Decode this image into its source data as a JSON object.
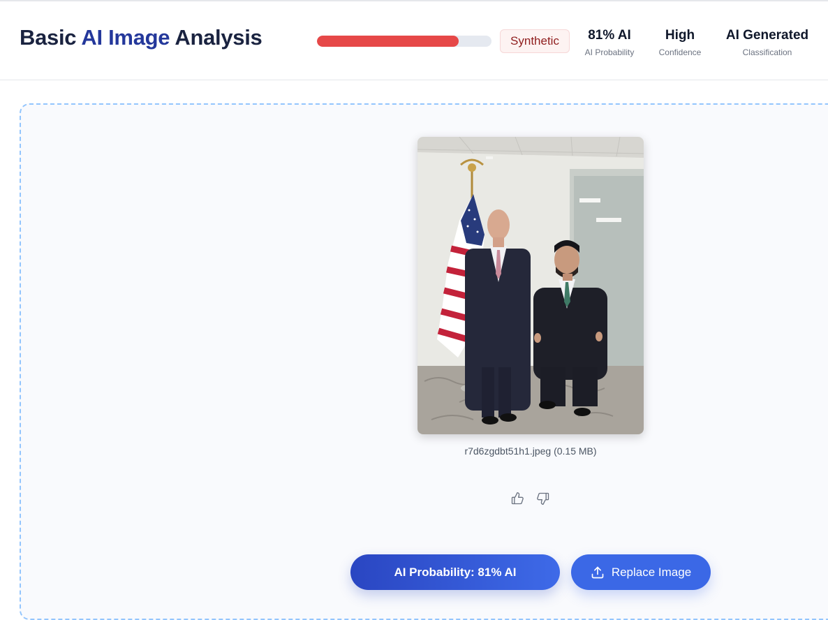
{
  "header": {
    "title_parts": [
      "Basic",
      "AI Image",
      "Analysis"
    ],
    "progress": 0.81,
    "progress_color": "#e64848",
    "badge": "Synthetic",
    "stats": [
      {
        "value": "81% AI",
        "label": "AI Probability"
      },
      {
        "value": "High",
        "label": "Confidence"
      },
      {
        "value": "AI Generated",
        "label": "Classification"
      }
    ]
  },
  "main": {
    "filename": "r7d6zgdbt51h1.jpeg (0.15 MB)",
    "feedback": {
      "up_icon": "thumbs-up-icon",
      "down_icon": "thumbs-down-icon"
    },
    "buttons": {
      "probability_label": "AI Probability: 81% AI",
      "replace_label": "Replace Image",
      "replace_icon": "upload-icon"
    }
  },
  "colors": {
    "accent": "#3b68e6",
    "title_dark": "#1a2340",
    "title_blue": "#24389b",
    "danger": "#e64848"
  }
}
